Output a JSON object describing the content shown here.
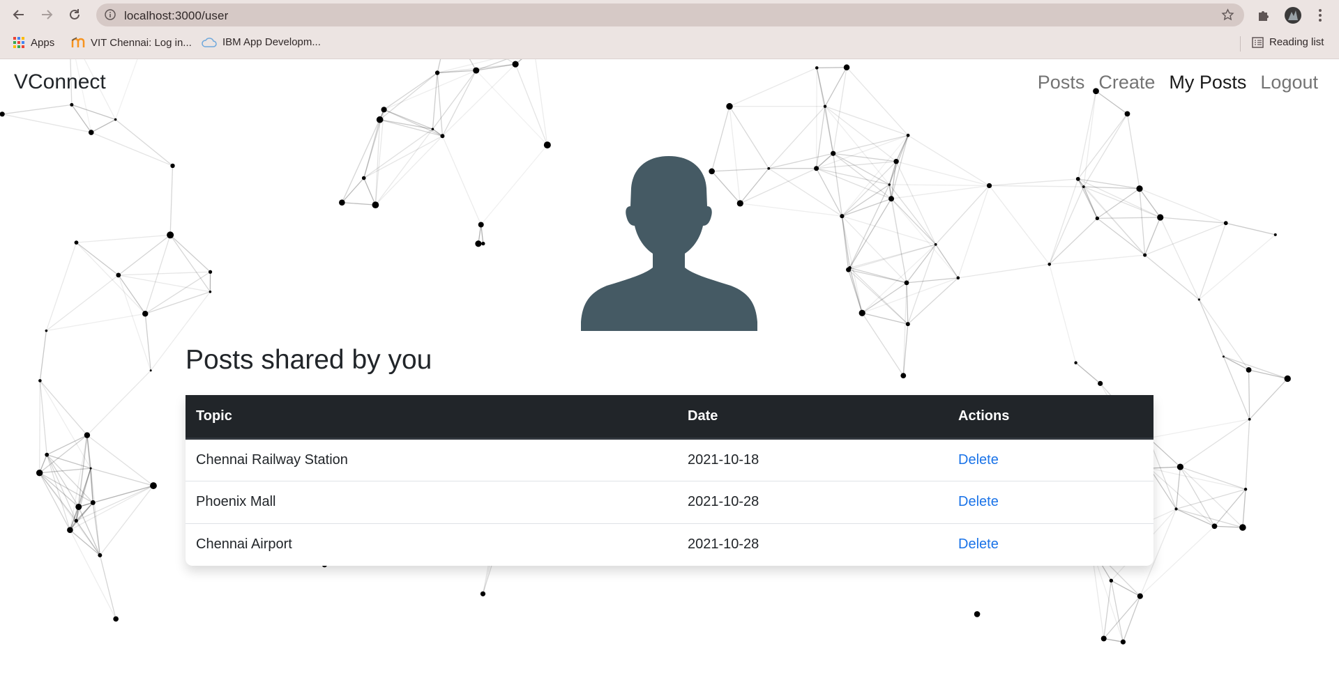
{
  "browser": {
    "url": "localhost:3000/user",
    "bookmarks": [
      {
        "label": "Apps",
        "icon": "apps-grid-icon"
      },
      {
        "label": "VIT Chennai: Log in...",
        "icon": "moodle-icon"
      },
      {
        "label": "IBM App Developm...",
        "icon": "cloud-icon"
      }
    ],
    "reading_list_label": "Reading list"
  },
  "navbar": {
    "brand": "VConnect",
    "links": [
      {
        "label": "Posts",
        "active": false
      },
      {
        "label": "Create",
        "active": false
      },
      {
        "label": "My Posts",
        "active": true
      },
      {
        "label": "Logout",
        "active": false
      }
    ]
  },
  "main": {
    "avatar_icon": "user-silhouette-icon",
    "heading": "Posts shared by you",
    "table": {
      "columns": [
        "Topic",
        "Date",
        "Actions"
      ],
      "rows": [
        {
          "topic": "Chennai Railway Station",
          "date": "2021-10-18",
          "action": "Delete"
        },
        {
          "topic": "Phoenix Mall",
          "date": "2021-10-28",
          "action": "Delete"
        },
        {
          "topic": "Chennai Airport",
          "date": "2021-10-28",
          "action": "Delete"
        }
      ]
    }
  },
  "colors": {
    "navbar_text": "#212529",
    "table_header_bg": "#212529",
    "link": "#1a73e8",
    "avatar": "#455a64",
    "browser_chrome": "#ece4e2"
  }
}
